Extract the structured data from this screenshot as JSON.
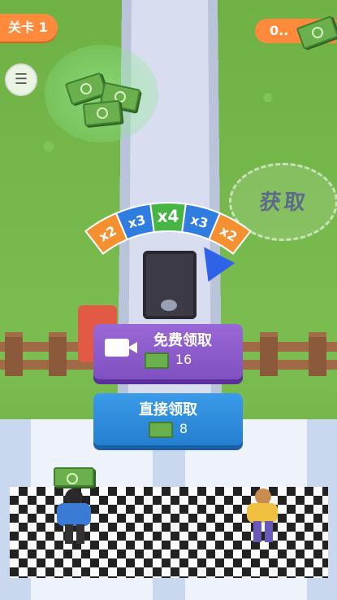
{
  "hud": {
    "level_label": "关卡 1",
    "money_value": "0..",
    "side_icon": "vibration-icon"
  },
  "world": {
    "collect_zone_label": "获取",
    "multiplier_segments": [
      "x2",
      "x3",
      "x4",
      "x3",
      "x2"
    ],
    "segment_colors": [
      "#f4902f",
      "#2f7de0",
      "#46b544",
      "#2f7de0",
      "#f4902f"
    ]
  },
  "buttons": {
    "free_claim": {
      "label": "免费领取",
      "amount": "16",
      "icon": "video-camera-icon"
    },
    "direct_claim": {
      "label": "直接领取",
      "amount": "8",
      "icon": "cash-icon"
    }
  },
  "colors": {
    "orange": "#ff8a3c",
    "purple": "#8a5ccc",
    "blue": "#2f8ee0"
  }
}
